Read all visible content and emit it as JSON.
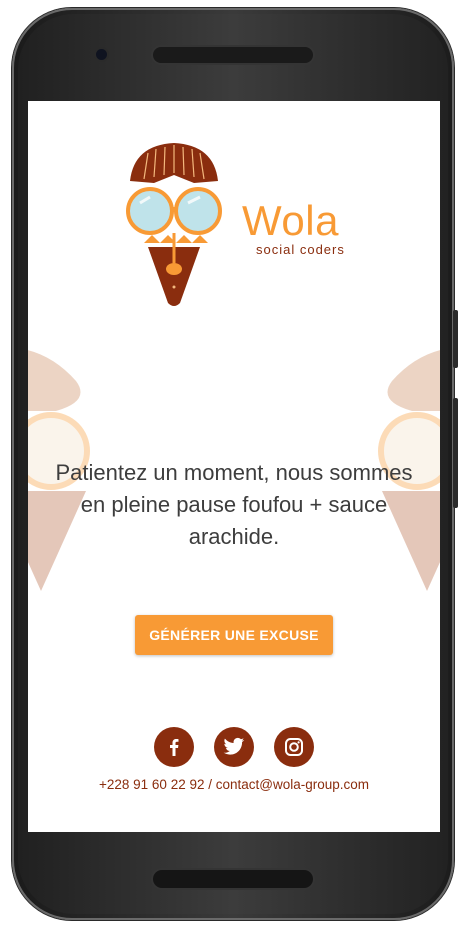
{
  "brand": {
    "name": "Wola",
    "tagline": "social coders",
    "name_color": "#f89a35",
    "mask_color": "#8a2d0e"
  },
  "main": {
    "message": "Patientez un moment, nous sommes en pleine pause foufou + sauce arachide.",
    "cta_label": "GÉNÉRER UNE EXCUSE",
    "accent_color": "#f89a35"
  },
  "footer": {
    "social": [
      {
        "icon": "facebook-icon"
      },
      {
        "icon": "twitter-icon"
      },
      {
        "icon": "instagram-icon"
      }
    ],
    "contact": "+228 91 60 22 92 / contact@wola-group.com"
  }
}
